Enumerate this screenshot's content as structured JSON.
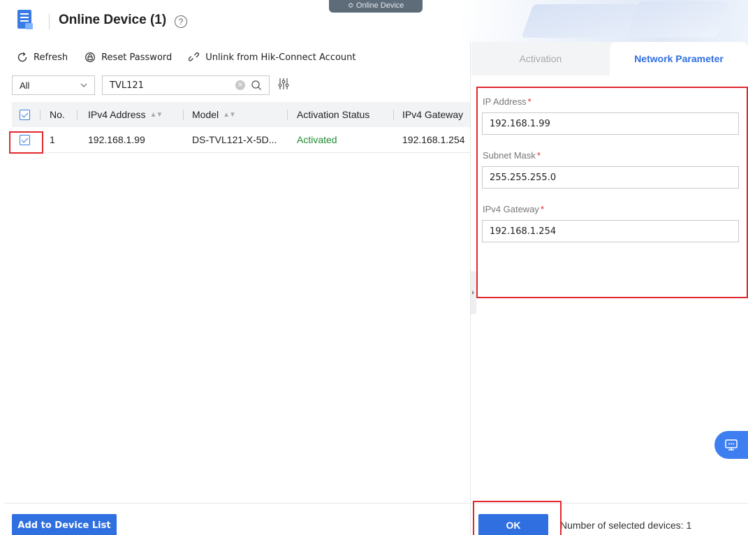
{
  "header": {
    "title": "Online Device (1)",
    "help": "?",
    "top_pill": "≎ Online Device"
  },
  "toolbar": {
    "refresh": "Refresh",
    "reset_password": "Reset Password",
    "unlink": "Unlink from Hik-Connect Account"
  },
  "filter": {
    "select_value": "All",
    "search_value": "TVL121",
    "clear": "×"
  },
  "table": {
    "columns": [
      "No.",
      "IPv4 Address",
      "Model",
      "Activation Status",
      "IPv4 Gateway"
    ],
    "rows": [
      {
        "no": "1",
        "ipv4": "192.168.1.99",
        "model": "DS-TVL121-X-5D...",
        "status": "Activated",
        "gateway": "192.168.1.254"
      }
    ]
  },
  "add_button": "Add to Device List",
  "panel": {
    "tabs": [
      "Activation",
      "Network Parameter"
    ],
    "ip_label": "IP Address",
    "ip_value": "192.168.1.99",
    "subnet_label": "Subnet Mask",
    "subnet_value": "255.255.255.0",
    "gateway_label": "IPv4 Gateway",
    "gateway_value": "192.168.1.254",
    "required_mark": "*",
    "ok": "OK",
    "selected_count": "Number of selected devices: 1"
  },
  "colors": {
    "accent": "#2f6fe0",
    "activated": "#1f8b32",
    "highlight": "#e0282e"
  }
}
